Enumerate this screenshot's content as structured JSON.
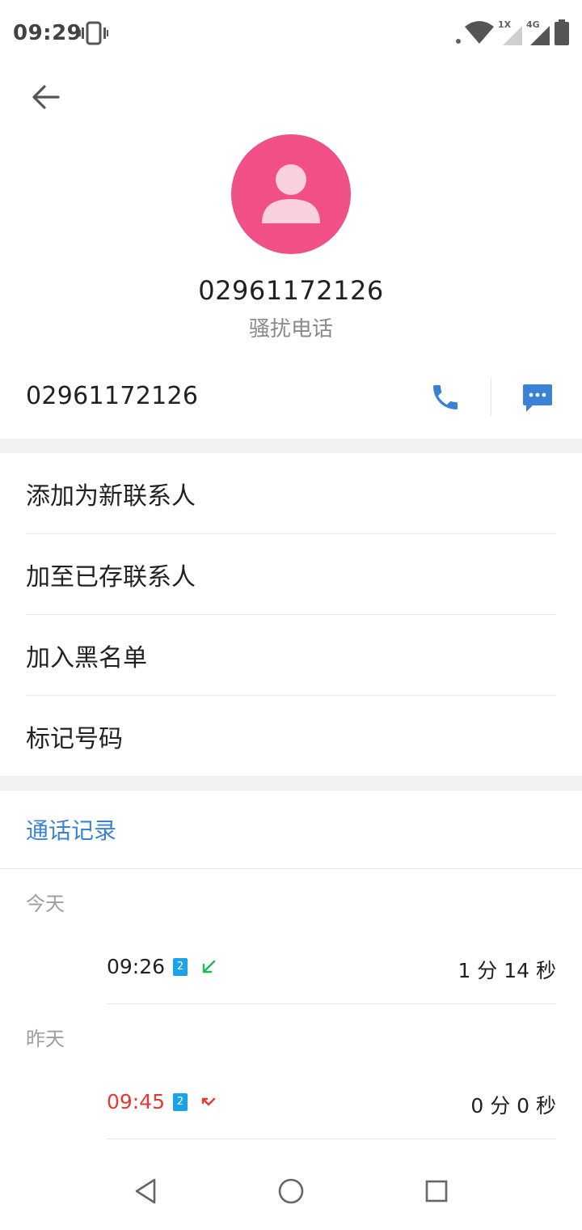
{
  "status_bar": {
    "time": "09:29",
    "signal1_label": "1X",
    "signal2_label": "4G"
  },
  "contact": {
    "number": "02961172126",
    "label": "骚扰电话"
  },
  "number_row": {
    "number": "02961172126"
  },
  "actions": [
    {
      "label": "添加为新联系人"
    },
    {
      "label": "加至已存联系人"
    },
    {
      "label": "加入黑名单"
    },
    {
      "label": "标记号码"
    }
  ],
  "call_log": {
    "header": "通话记录",
    "groups": [
      {
        "day": "今天",
        "entries": [
          {
            "time": "09:26",
            "sim": "2",
            "direction": "incoming",
            "duration": "1 分 14 秒"
          }
        ]
      },
      {
        "day": "昨天",
        "entries": [
          {
            "time": "09:45",
            "sim": "2",
            "direction": "missed",
            "duration": "0 分 0 秒"
          }
        ]
      }
    ]
  },
  "colors": {
    "accent": "#3b82d6",
    "avatar": "#f05085",
    "missed": "#e53935",
    "incoming": "#1db954",
    "sim": "#1aa3e8"
  }
}
